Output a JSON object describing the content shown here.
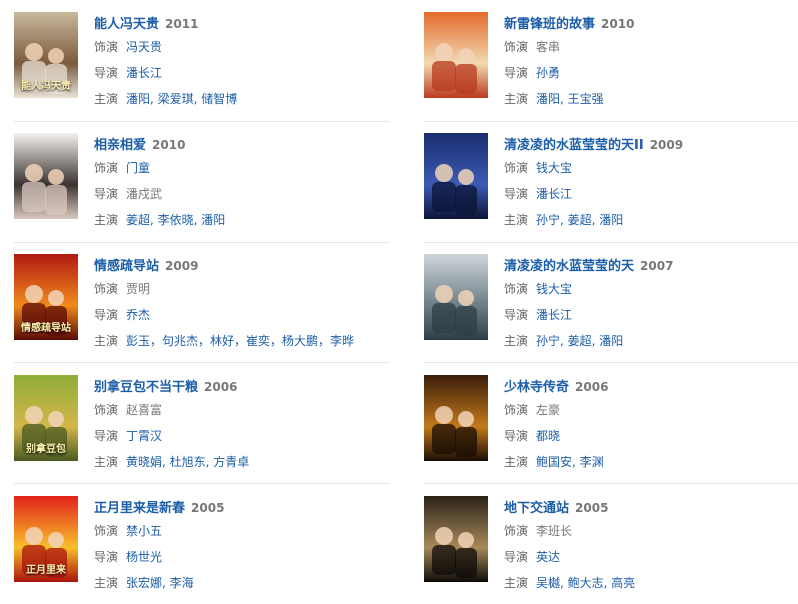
{
  "labels": {
    "role": "饰演",
    "director": "导演",
    "cast": "主演"
  },
  "films": [
    {
      "title": "能人冯天贵",
      "year": "2011",
      "role": "冯天贵",
      "role_link": true,
      "director": "潘长江",
      "director_link": true,
      "cast": "潘阳, 梁爱琪, 储智博",
      "cast_link": true,
      "poster_text": "能人冯天贵",
      "poster_colors": [
        "#c9b89a",
        "#7b5a3c",
        "#e8e2d6"
      ]
    },
    {
      "title": "新雷锋班的故事",
      "year": "2010",
      "role": "客串",
      "role_link": false,
      "director": "孙勇",
      "director_link": true,
      "cast": "潘阳, 王宝强",
      "cast_link": true,
      "poster_text": "",
      "poster_colors": [
        "#e46a2c",
        "#f2d9b3",
        "#b83a1e"
      ]
    },
    {
      "title": "相亲相爱",
      "year": "2010",
      "role": "门童",
      "role_link": true,
      "director": "潘戍武",
      "director_link": false,
      "cast": "姜超, 李依晓, 潘阳",
      "cast_link": true,
      "poster_text": "",
      "poster_colors": [
        "#f4f2ef",
        "#3b3330",
        "#d9c9c0"
      ]
    },
    {
      "title": "清凌凌的水蓝莹莹的天II",
      "year": "2009",
      "role": "钱大宝",
      "role_link": true,
      "director": "潘长江",
      "director_link": true,
      "cast": "孙宁, 姜超, 潘阳",
      "cast_link": true,
      "poster_text": "",
      "poster_colors": [
        "#1a2d6e",
        "#3b5bb5",
        "#0c1436"
      ]
    },
    {
      "title": "情感疏导站",
      "year": "2009",
      "role": "贾明",
      "role_link": false,
      "director": "乔杰",
      "director_link": true,
      "cast": "彭玉，句兆杰，林好，崔奕，杨大鹏，李晔",
      "cast_link": true,
      "poster_text": "情感疏导站",
      "poster_colors": [
        "#b11a12",
        "#f08a1c",
        "#5a0a06"
      ]
    },
    {
      "title": "清凌凌的水蓝莹莹的天",
      "year": "2007",
      "role": "钱大宝",
      "role_link": true,
      "director": "潘长江",
      "director_link": true,
      "cast": "孙宁, 姜超, 潘阳",
      "cast_link": true,
      "poster_text": "",
      "poster_colors": [
        "#cfd6da",
        "#6c7d86",
        "#2e3d45"
      ]
    },
    {
      "title": "别拿豆包不当干粮",
      "year": "2006",
      "role": "赵喜富",
      "role_link": false,
      "director": "丁霄汉",
      "director_link": true,
      "cast": "黄晓娟, 杜旭东, 方青卓",
      "cast_link": true,
      "poster_text": "别拿豆包",
      "poster_colors": [
        "#8fae3a",
        "#d4b64a",
        "#4a5a22"
      ]
    },
    {
      "title": "少林寺传奇",
      "year": "2006",
      "role": "左豪",
      "role_link": false,
      "director": "都晓",
      "director_link": true,
      "cast": "鲍国安, 李渊",
      "cast_link": true,
      "poster_text": "",
      "poster_colors": [
        "#3a1c0a",
        "#c47a1c",
        "#1a0c04"
      ]
    },
    {
      "title": "正月里来是新春",
      "year": "2005",
      "role": "禁小五",
      "role_link": true,
      "director": "杨世光",
      "director_link": true,
      "cast": "张宏娜, 李海",
      "cast_link": true,
      "poster_text": "正月里来",
      "poster_colors": [
        "#e2221a",
        "#f7c02a",
        "#a8120c"
      ]
    },
    {
      "title": "地下交通站",
      "year": "2005",
      "role": "李班长",
      "role_link": false,
      "director": "英达",
      "director_link": true,
      "cast": "吴樾, 鲍大志, 高亮",
      "cast_link": true,
      "poster_text": "",
      "poster_colors": [
        "#2a2218",
        "#a88a5a",
        "#0e0b08"
      ]
    }
  ]
}
